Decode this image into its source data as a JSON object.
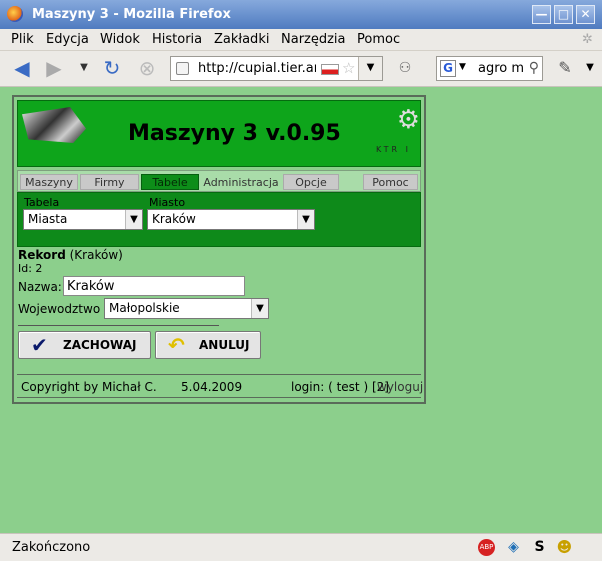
{
  "window": {
    "title": "Maszyny 3 - Mozilla Firefox",
    "buttons": [
      "—",
      "□",
      "✕"
    ]
  },
  "menu": [
    "Plik",
    "Edycja",
    "Widok",
    "Historia",
    "Zakładki",
    "Narzędzia",
    "Pomoc"
  ],
  "nav": {
    "url": "http://cupial.tier.ar",
    "search_value": "agro m",
    "search_engine": "G"
  },
  "page": {
    "heading": "Maszyny 3 v.0.95",
    "logo_right_text": "KTR I",
    "tabs": [
      {
        "label": "Maszyny",
        "active": false
      },
      {
        "label": "Firmy",
        "active": false
      },
      {
        "label": "Tabele",
        "active": true
      },
      {
        "label": "Administracja",
        "active": false
      },
      {
        "label": "Opcje",
        "active": false
      },
      {
        "label": "Pomoc",
        "active": false
      }
    ],
    "filters": {
      "tabela_label": "Tabela",
      "tabela_value": "Miasta",
      "miasto_label": "Miasto",
      "miasto_value": "Kraków"
    },
    "record": {
      "title": "Rekord",
      "subtitle": "(Kraków)",
      "id_line": "Id: 2"
    },
    "form": {
      "nazwa_label": "Nazwa:",
      "nazwa_value": "Kraków",
      "woj_label": "Wojewodztwo :",
      "woj_value": "Małopolskie"
    },
    "buttons": {
      "save": "ZACHOWAJ",
      "cancel": "ANULUJ"
    },
    "footer": {
      "copyright": "Copyright by Michał C.",
      "date": "5.04.2009",
      "login": "login: ( test ) [2]",
      "logout": "wyloguj"
    }
  },
  "status": {
    "text": "Zakończono"
  },
  "colors": {
    "page_bg": "#8ccf8c",
    "banner": "#0ea51b",
    "filterbar": "#0e8a1a"
  }
}
